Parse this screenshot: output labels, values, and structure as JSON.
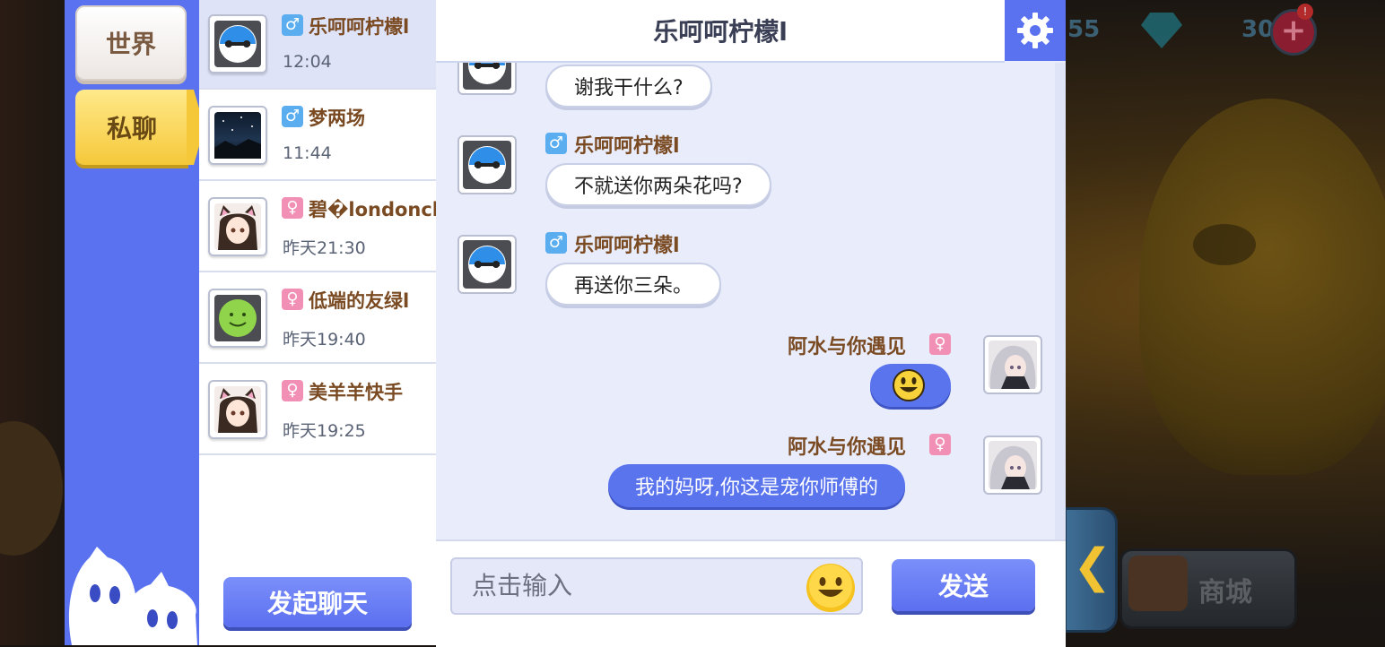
{
  "tabs": {
    "world": "世界",
    "private": "私聊"
  },
  "contacts": [
    {
      "name": "乐呵呵柠檬l",
      "time": "12:04",
      "gender": "male",
      "avatar": "baymax-avatar",
      "active": true
    },
    {
      "name": "梦两场",
      "time": "11:44",
      "gender": "male",
      "avatar": "night-sky-avatar",
      "active": false
    },
    {
      "name": "碧�londoncl",
      "time": "昨天21:30",
      "gender": "female",
      "avatar": "catgirl-avatar",
      "active": false
    },
    {
      "name": "低端的友绿l",
      "time": "昨天19:40",
      "gender": "female",
      "avatar": "green-smiley-avatar",
      "active": false
    },
    {
      "name": "美羊羊快手",
      "time": "昨天19:25",
      "gender": "female",
      "avatar": "catgirl-avatar",
      "active": false
    }
  ],
  "start_chat_label": "发起聊天",
  "chat": {
    "title": "乐呵呵柠檬l",
    "settings_icon": "gear-icon",
    "messages": [
      {
        "side": "left",
        "sender": "",
        "text": "谢我干什么?"
      },
      {
        "side": "left",
        "sender": "乐呵呵柠檬l",
        "text": "不就送你两朵花吗?"
      },
      {
        "side": "left",
        "sender": "乐呵呵柠檬l",
        "text": "再送你三朵。"
      },
      {
        "side": "right",
        "sender": "阿水与你遇见",
        "text": "",
        "emoji": "smiley-emoji"
      },
      {
        "side": "right",
        "sender": "阿水与你遇见",
        "text": "我的妈呀,你这是宠你师傅的"
      }
    ]
  },
  "input": {
    "placeholder": "点击输入",
    "emoji_icon": "smiley-icon"
  },
  "send_label": "发送",
  "game": {
    "hud_left_number": "55",
    "hud_right_number": "30",
    "notification": "!",
    "shop_label": "商城"
  },
  "colors": {
    "sidebar": "#5a72f0",
    "accent_yellow": "#f5c83a",
    "name_brown": "#7a4a22",
    "male": "#5aaef0",
    "female": "#f28fb5"
  }
}
